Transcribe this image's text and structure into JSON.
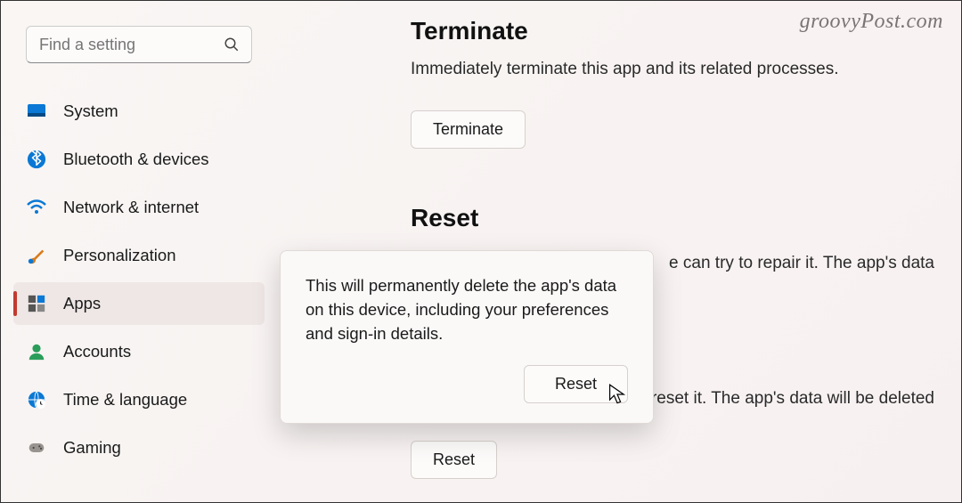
{
  "watermark": "groovyPost.com",
  "search": {
    "placeholder": "Find a setting"
  },
  "sidebar": {
    "items": [
      {
        "label": "System"
      },
      {
        "label": "Bluetooth & devices"
      },
      {
        "label": "Network & internet"
      },
      {
        "label": "Personalization"
      },
      {
        "label": "Apps"
      },
      {
        "label": "Accounts"
      },
      {
        "label": "Time & language"
      },
      {
        "label": "Gaming"
      }
    ]
  },
  "main": {
    "terminate": {
      "title": "Terminate",
      "desc": "Immediately terminate this app and its related processes.",
      "button": "Terminate"
    },
    "reset": {
      "title": "Reset",
      "repair_fragment": "e can try to repair it. The app's data",
      "reset_fragment": "t, reset it. The app's data will be deleted",
      "button": "Reset"
    }
  },
  "popup": {
    "text": "This will permanently delete the app's data on this device, including your preferences and sign-in details.",
    "button": "Reset"
  }
}
